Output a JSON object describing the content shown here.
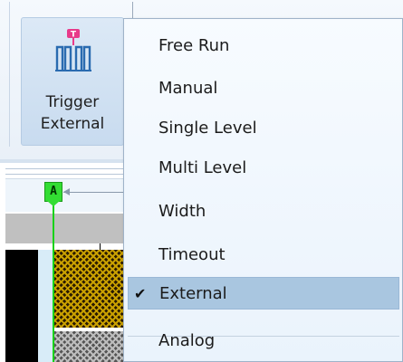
{
  "toolbar": {
    "trigger_button": {
      "line1": "Trigger",
      "line2": "External",
      "icon": "trigger-waveform-icon",
      "icon_badge": "T",
      "icon_color": "#2a6bb0",
      "badge_color": "#e83a8a"
    }
  },
  "timeline": {
    "marker_label": "A",
    "marker_color": "#33dd33"
  },
  "trigger_menu": {
    "items": [
      {
        "label": "Free Run",
        "checked": false
      },
      {
        "label": "Manual",
        "checked": false
      },
      {
        "label": "Single Level",
        "checked": false
      },
      {
        "label": "Multi Level",
        "checked": false
      },
      {
        "label": "Width",
        "checked": false
      },
      {
        "label": "Timeout",
        "checked": false
      },
      {
        "label": "External",
        "checked": true
      },
      {
        "label": "Analog",
        "checked": false
      }
    ],
    "check_glyph": "✔",
    "selected_bg": "#a9c6e0"
  }
}
